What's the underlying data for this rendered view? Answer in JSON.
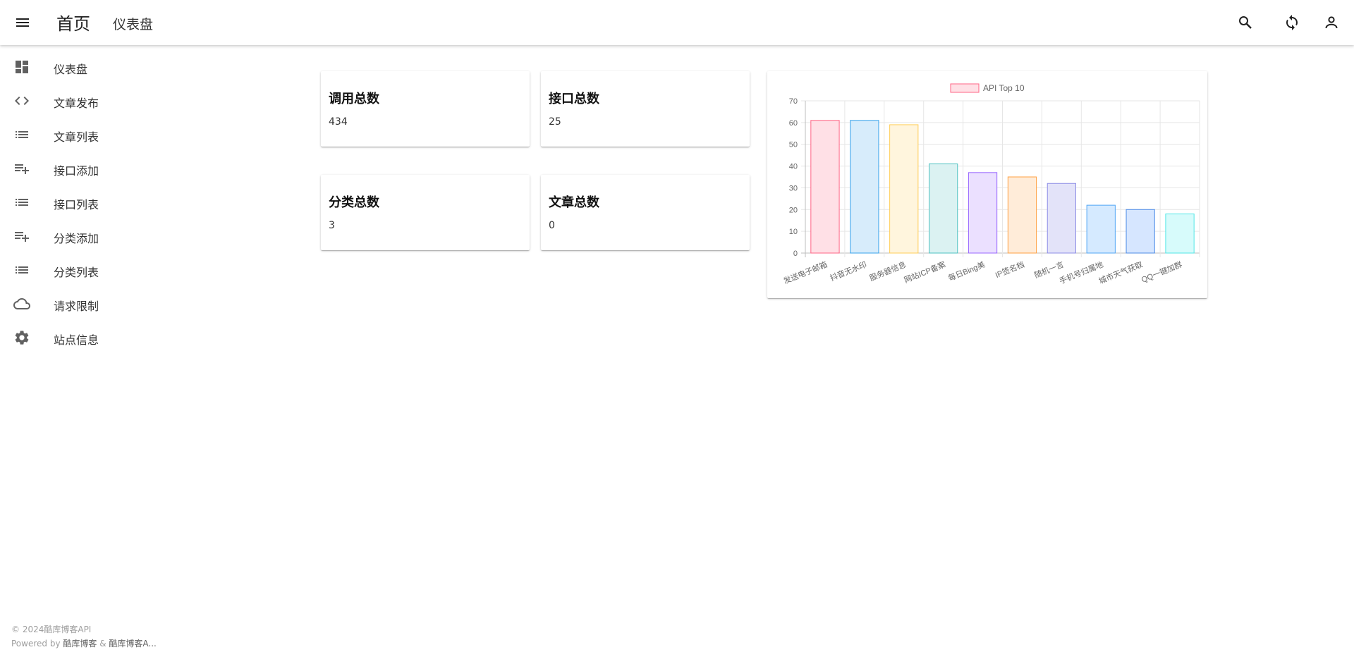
{
  "appbar": {
    "home_title": "首页",
    "sub_title": "仪表盘",
    "icons": [
      "menu-icon",
      "search-icon",
      "refresh-icon",
      "account-icon"
    ]
  },
  "sidebar": {
    "items": [
      {
        "label": "仪表盘",
        "icon": "dashboard-icon"
      },
      {
        "label": "文章发布",
        "icon": "code-icon"
      },
      {
        "label": "文章列表",
        "icon": "list-icon"
      },
      {
        "label": "接口添加",
        "icon": "playlist-add-icon"
      },
      {
        "label": "接口列表",
        "icon": "list-icon"
      },
      {
        "label": "分类添加",
        "icon": "playlist-add-icon"
      },
      {
        "label": "分类列表",
        "icon": "list-icon"
      },
      {
        "label": "请求限制",
        "icon": "cloud-icon"
      },
      {
        "label": "站点信息",
        "icon": "settings-icon"
      }
    ]
  },
  "stats": {
    "calls": {
      "title": "调用总数",
      "value": "434"
    },
    "apis": {
      "title": "接口总数",
      "value": "25"
    },
    "categories": {
      "title": "分类总数",
      "value": "3"
    },
    "articles": {
      "title": "文章总数",
      "value": "0"
    }
  },
  "footer": {
    "copyright": "© 2024酷库博客API",
    "powered_prefix": "Powered by ",
    "brand1": "酷库博客",
    "amp": " & ",
    "brand2": "酷库博客A..."
  },
  "chart_data": {
    "type": "bar",
    "title": "",
    "legend": "API Top 10",
    "legend_position": "top",
    "grid": true,
    "ylim": [
      0,
      70
    ],
    "yticks": [
      0,
      10,
      20,
      30,
      40,
      50,
      60,
      70
    ],
    "categories": [
      "发送电子邮箱",
      "抖音无水印",
      "服务器信息",
      "网站ICP备案",
      "每日Bing美",
      "IP签名档",
      "随机一言",
      "手机号归属地",
      "城市天气获取",
      "QQ一键加群"
    ],
    "series": [
      {
        "name": "API Top 10",
        "values": [
          61,
          61,
          59,
          41,
          37,
          35,
          32,
          22,
          20,
          18
        ]
      }
    ],
    "colors": {
      "fill": [
        "#ffe0e6",
        "#d7ecfb",
        "#fff5dd",
        "#dbf2f2",
        "#ebe0ff",
        "#ffecd9",
        "#e3e3f9",
        "#d5eaff",
        "#d6e6ff",
        "#d7fbfb"
      ],
      "stroke": [
        "#ff6384",
        "#36a2eb",
        "#ffcd56",
        "#4bc0c0",
        "#9966ff",
        "#ff9f40",
        "#8c8ce6",
        "#4fa5f5",
        "#4c8be6",
        "#4fe6e6"
      ]
    }
  }
}
